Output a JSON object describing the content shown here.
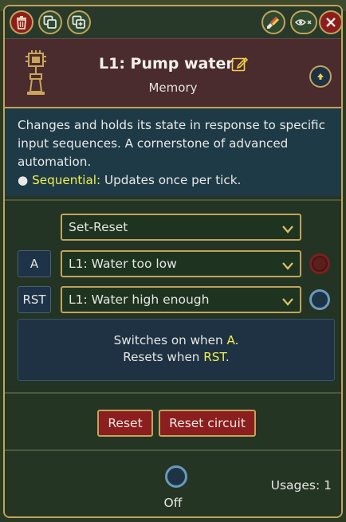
{
  "toolbar": {
    "delete_icon": "trash-icon",
    "copy_icon": "copy-icon",
    "duplicate_icon": "duplicate-plus-icon",
    "paint_icon": "paintbrush-icon",
    "visibility_icon": "eye-x-icon",
    "close_icon": "close-x-icon"
  },
  "header": {
    "title": "L1: Pump water",
    "subtitle": "Memory",
    "icon": "memory-chip-icon",
    "edit_icon": "edit-pencil-icon"
  },
  "description": {
    "text": "Changes and holds its state in response to specific input sequences. A cornerstone of advanced automation.",
    "bullet": "●",
    "tag": "Sequential:",
    "tag_text": "Updates once per tick."
  },
  "config": {
    "mode": "Set-Reset",
    "inputs": [
      {
        "label": "A",
        "value": "L1: Water too low",
        "state": "red"
      },
      {
        "label": "RST",
        "value": "L1: Water high enough",
        "state": "blue"
      }
    ],
    "info": {
      "line1_prefix": "Switches on when ",
      "line1_key": "A",
      "line1_suffix": ".",
      "line2_prefix": "Resets when ",
      "line2_key": "RST",
      "line2_suffix": "."
    }
  },
  "actions": {
    "reset_label": "Reset",
    "reset_circuit_label": "Reset circuit"
  },
  "status": {
    "state": "Off",
    "usages": "Usages: 1"
  },
  "colors": {
    "gold_border": "#c2a35a",
    "header_bg": "#4a2b2e",
    "desc_bg": "#1f3a47",
    "accent_yellow": "#f2f04a",
    "button_red": "#8b1e1e"
  }
}
